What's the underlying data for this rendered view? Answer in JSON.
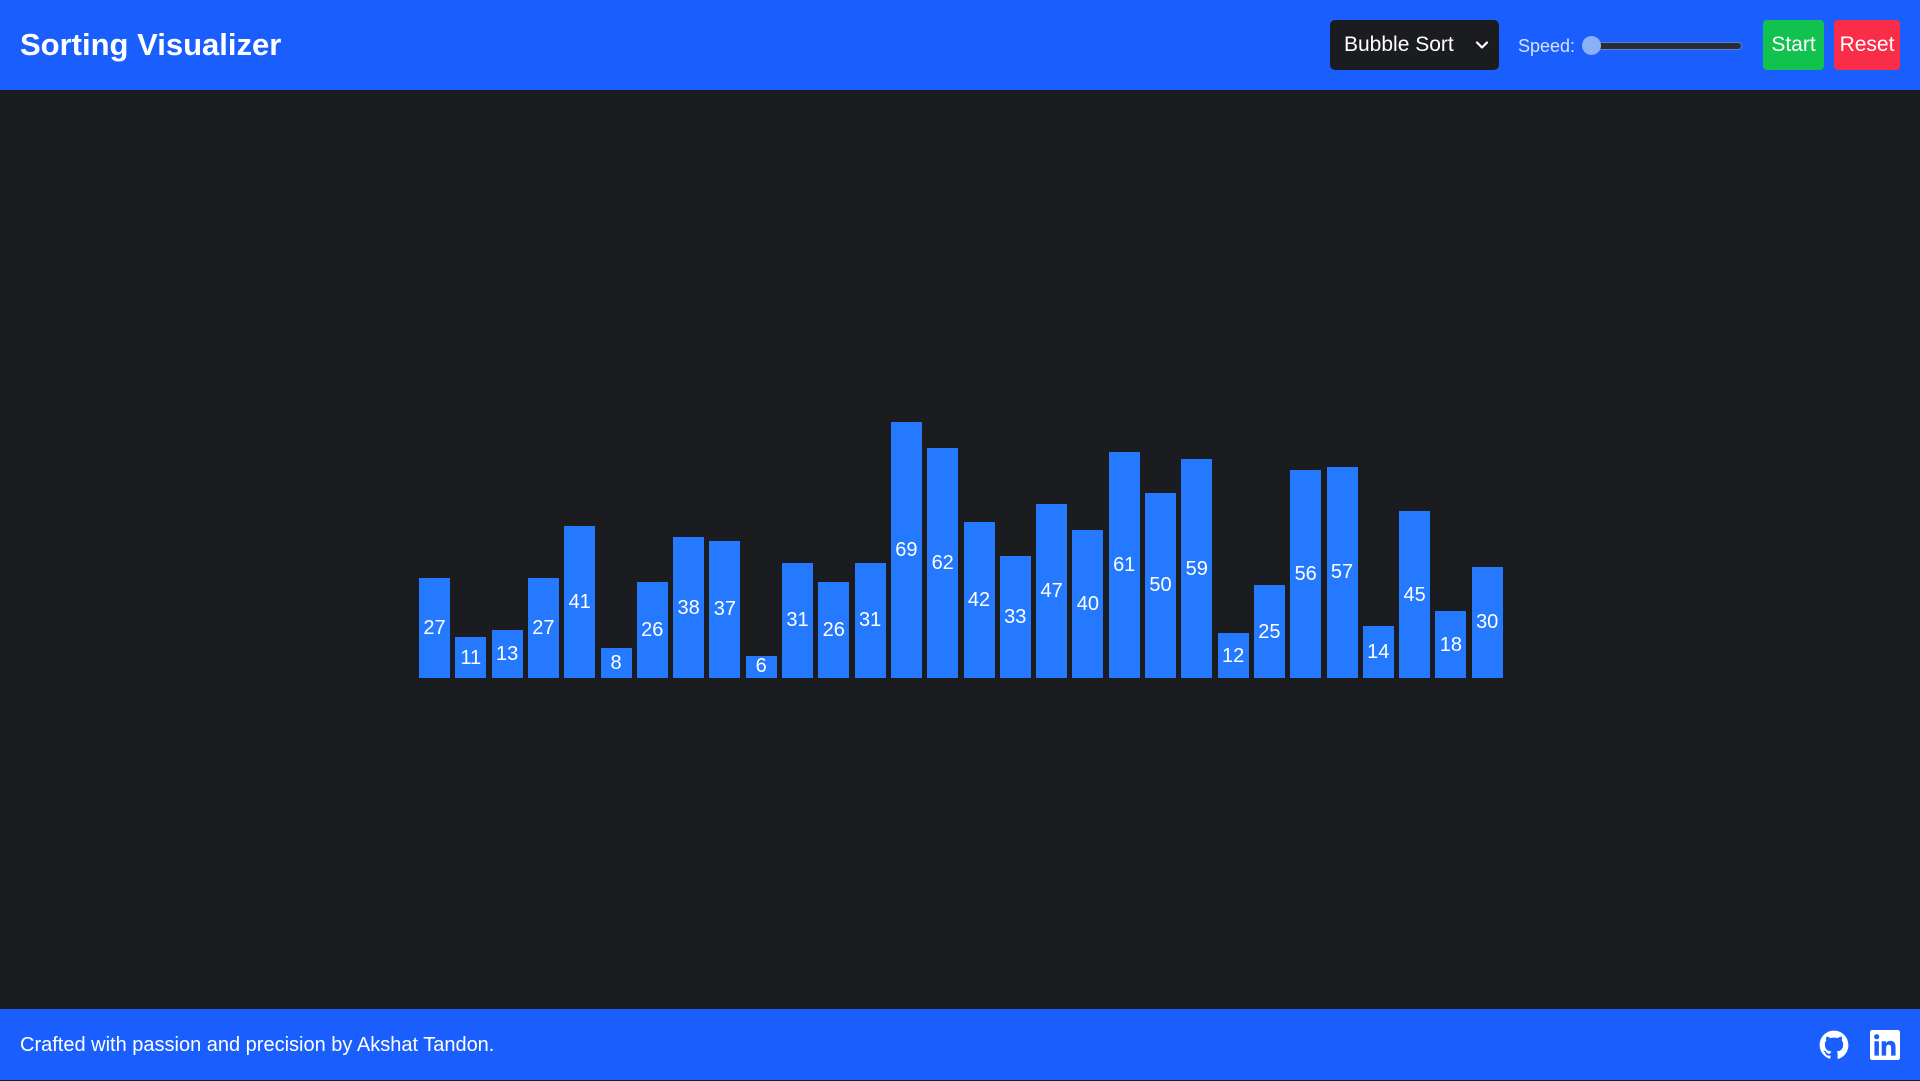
{
  "header": {
    "title": "Sorting Visualizer",
    "algorithm_select": {
      "selected": "Bubble Sort",
      "icon": "chevron-down-icon"
    },
    "speed": {
      "label": "Speed:",
      "value_fraction": 0.0
    },
    "start_label": "Start",
    "reset_label": "Reset"
  },
  "chart_data": {
    "type": "bar",
    "values": [
      27,
      11,
      13,
      27,
      41,
      8,
      26,
      38,
      37,
      6,
      31,
      26,
      31,
      69,
      62,
      42,
      33,
      47,
      40,
      61,
      50,
      59,
      12,
      25,
      56,
      57,
      14,
      45,
      18,
      30
    ]
  },
  "footer": {
    "text": "Crafted with passion and precision by Akshat Tandon.",
    "icons": [
      "github-icon",
      "linkedin-icon"
    ]
  },
  "colors": {
    "navbar": "#1a5ffe",
    "background": "#1b1c1f",
    "bar": "#2479ff",
    "start": "#11c24f",
    "reset": "#fa2d48"
  }
}
